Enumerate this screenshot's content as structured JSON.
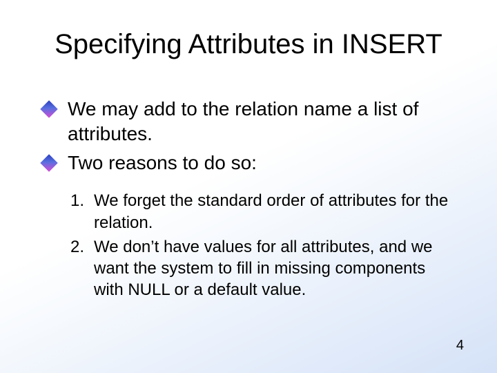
{
  "title": "Specifying Attributes in INSERT",
  "bullets": [
    "We may add to the relation name a list of attributes.",
    "Two reasons to do so:"
  ],
  "numbered": [
    {
      "n": "1.",
      "text": "We forget the standard order of attributes for the relation."
    },
    {
      "n": "2.",
      "text": "We don’t have values for all attributes, and we want the system to fill in missing components with NULL or a default value."
    }
  ],
  "page_number": "4"
}
